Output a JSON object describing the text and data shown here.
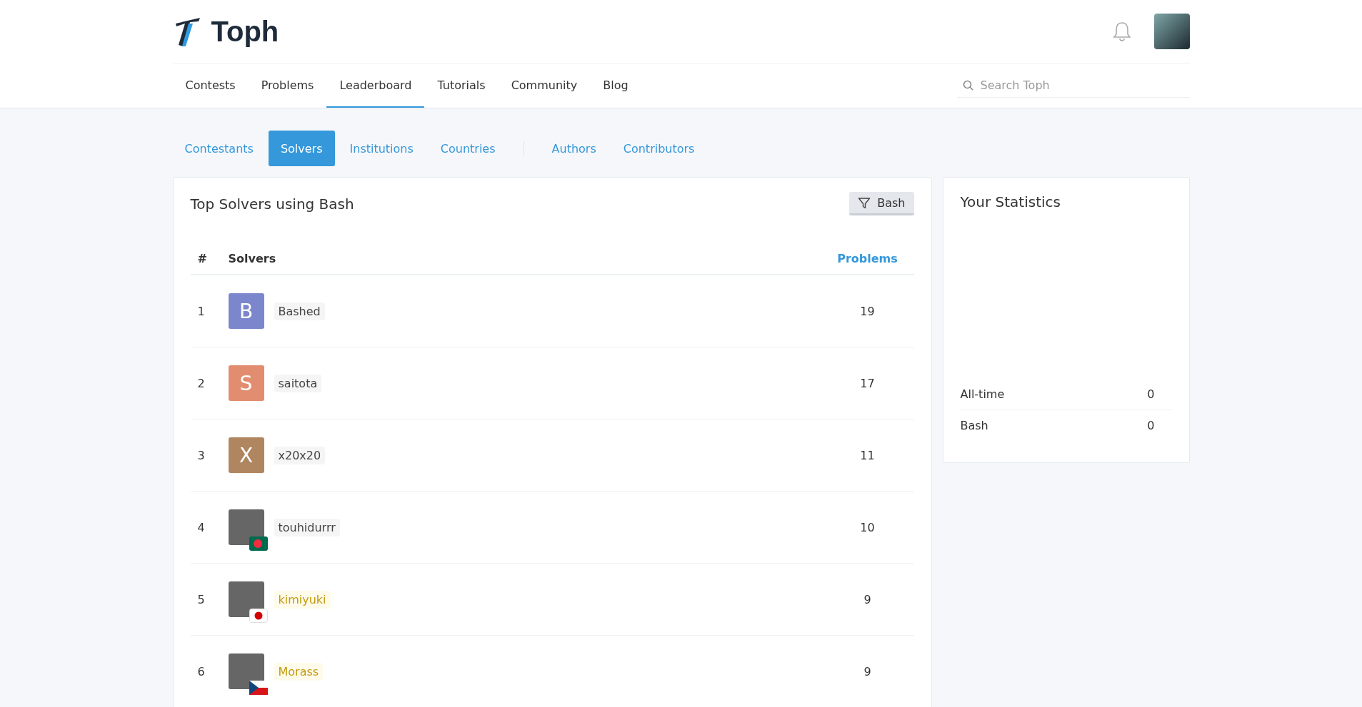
{
  "brand": {
    "name": "Toph"
  },
  "nav": [
    {
      "label": "Contests",
      "selected": false
    },
    {
      "label": "Problems",
      "selected": false
    },
    {
      "label": "Leaderboard",
      "selected": true
    },
    {
      "label": "Tutorials",
      "selected": false
    },
    {
      "label": "Community",
      "selected": false
    },
    {
      "label": "Blog",
      "selected": false
    }
  ],
  "search": {
    "placeholder": "Search Toph"
  },
  "subtabs": {
    "ranking": [
      {
        "label": "Contestants",
        "selected": false
      },
      {
        "label": "Solvers",
        "selected": true
      },
      {
        "label": "Institutions",
        "selected": false
      },
      {
        "label": "Countries",
        "selected": false
      }
    ],
    "credits": [
      {
        "label": "Authors",
        "selected": false
      },
      {
        "label": "Contributors",
        "selected": false
      }
    ]
  },
  "solvers_card": {
    "title": "Top Solvers using Bash",
    "filter_button": "Bash",
    "columns": [
      {
        "label": "#",
        "sorted": false
      },
      {
        "label": "Solvers",
        "sorted": false
      },
      {
        "label": "Problems",
        "sorted": true
      }
    ],
    "rows": [
      {
        "rank": "1",
        "avatar": {
          "kind": "letter",
          "letter": "B",
          "color": "#7b86cd"
        },
        "handle": "Bashed",
        "color": "#444444",
        "problems": "19"
      },
      {
        "rank": "2",
        "avatar": {
          "kind": "letter",
          "letter": "S",
          "color": "#e28d6f"
        },
        "handle": "saitota",
        "color": "#444444",
        "problems": "17"
      },
      {
        "rank": "3",
        "avatar": {
          "kind": "letter",
          "letter": "X",
          "color": "#b08660"
        },
        "handle": "x20x20",
        "color": "#444444",
        "problems": "11"
      },
      {
        "rank": "4",
        "avatar": {
          "kind": "photo",
          "flag": {
            "kind": "bd"
          }
        },
        "handle": "touhidurrr",
        "color": "#444444",
        "problems": "10"
      },
      {
        "rank": "5",
        "avatar": {
          "kind": "photo",
          "flag": {
            "kind": "jp"
          }
        },
        "handle": "kimiyuki",
        "color": "#c39a10",
        "problems": "9"
      },
      {
        "rank": "6",
        "avatar": {
          "kind": "photo",
          "flag": {
            "kind": "cz"
          }
        },
        "handle": "Morass",
        "color": "#c39a10",
        "problems": "9"
      }
    ]
  },
  "stats_card": {
    "title": "Your Statistics",
    "rows": [
      {
        "label": "All-time",
        "value": "0"
      },
      {
        "label": "Bash",
        "value": "0"
      }
    ]
  }
}
